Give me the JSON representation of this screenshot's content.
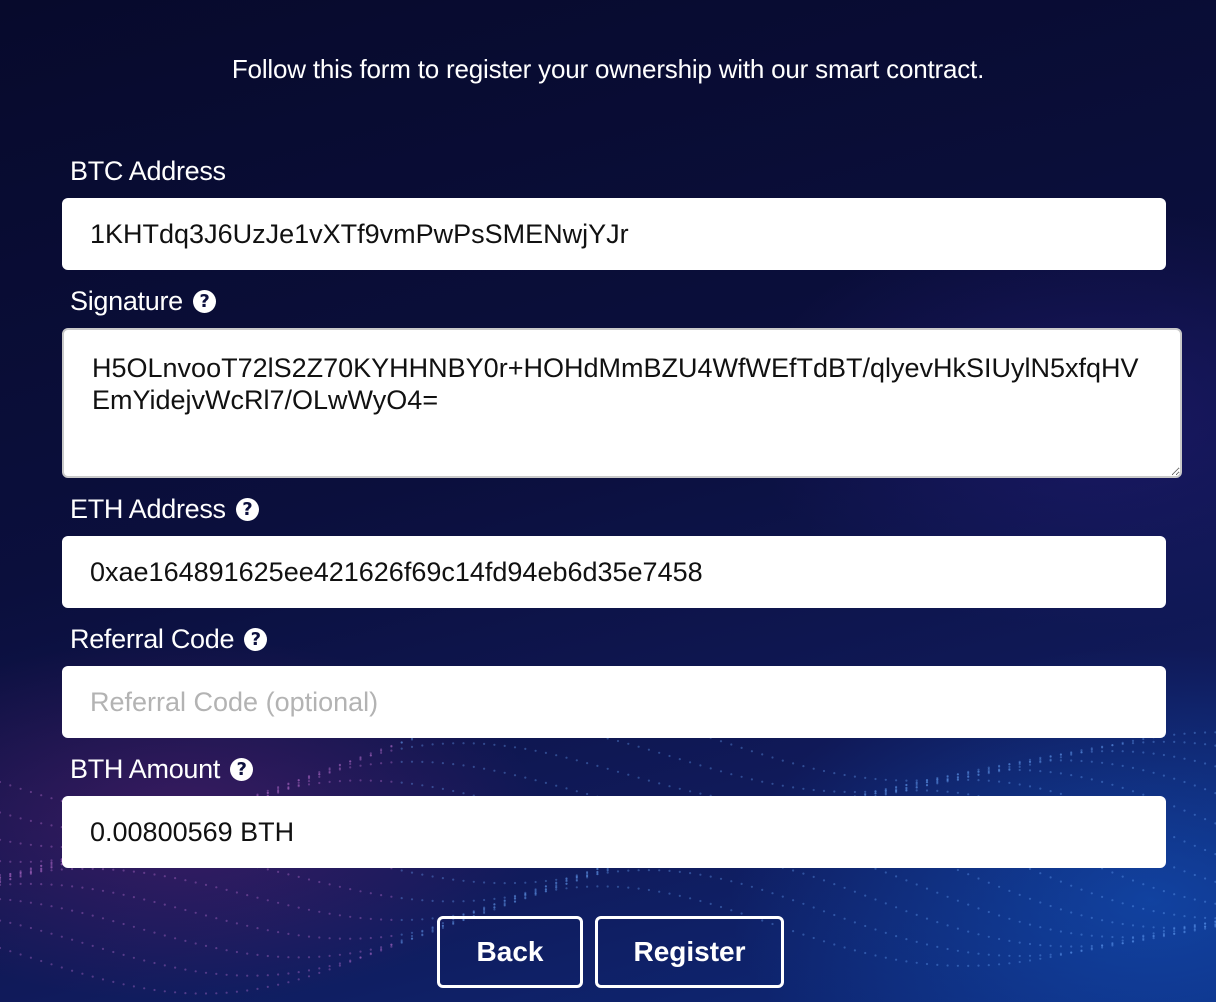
{
  "intro_text": "Follow this form to register your ownership with our smart contract.",
  "form": {
    "btc_address": {
      "label": "BTC Address",
      "value": "1KHTdq3J6UzJe1vXTf9vmPwPsSMENwjYJr"
    },
    "signature": {
      "label": "Signature",
      "value": "H5OLnvooT72lS2Z70KYHHNBY0r+HOHdMmBZU4WfWEfTdBT/qlyevHkSIUylN5xfqHVEmYidejvWcRl7/OLwWyO4="
    },
    "eth_address": {
      "label": "ETH Address",
      "value": "0xae164891625ee421626f69c14fd94eb6d35e7458"
    },
    "referral_code": {
      "label": "Referral Code",
      "value": "",
      "placeholder": "Referral Code (optional)"
    },
    "bth_amount": {
      "label": "BTH Amount",
      "value": "0.00800569 BTH"
    }
  },
  "buttons": {
    "back": "Back",
    "register": "Register"
  },
  "icons": {
    "help": "question-circle-icon"
  },
  "colors": {
    "background_top": "#070a2c",
    "background_bottom": "#0d2a7a",
    "text": "#ffffff",
    "input_bg": "#ffffff",
    "placeholder": "#b3b3b3"
  }
}
